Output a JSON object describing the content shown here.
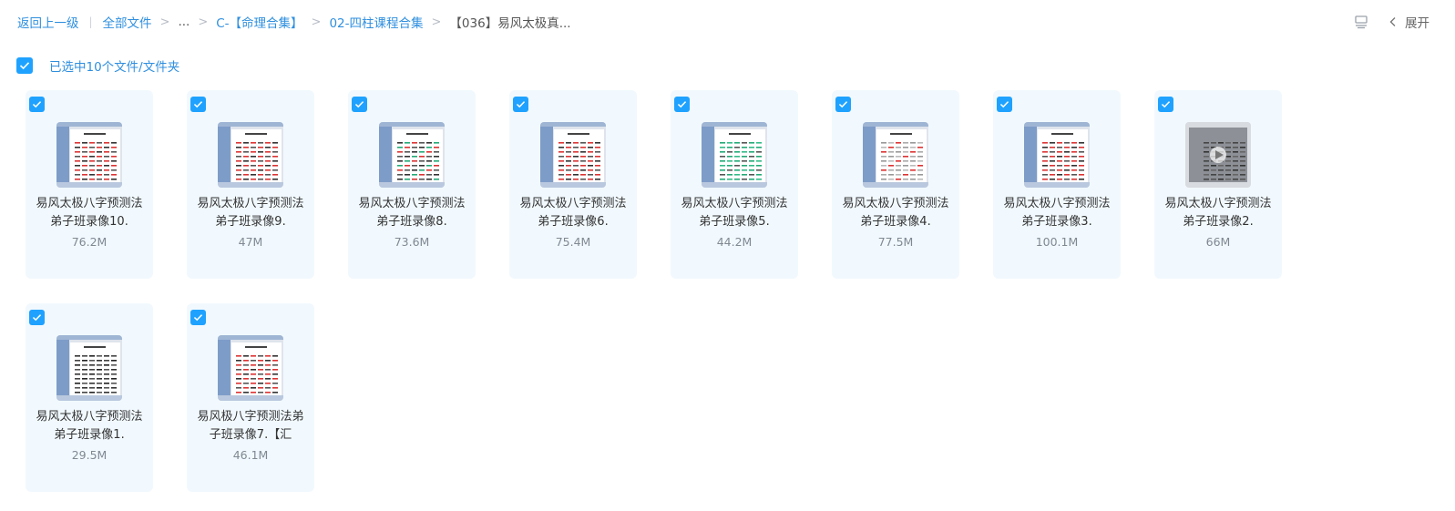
{
  "breadcrumb": {
    "back": "返回上一级",
    "all_files": "全部文件",
    "ellipsis": "...",
    "level1": "C-【命理合集】",
    "level2": "02-四柱课程合集",
    "current": "【036】易风太极真..."
  },
  "toolbar": {
    "expand": "展开",
    "view_icon": "list-view-icon"
  },
  "selection": {
    "text": "已选中10个文件/文件夹",
    "checked": true
  },
  "colors": {
    "accent": "#1fa2ff",
    "link": "#2f8fdf",
    "card_bg": "#f1f9fe"
  },
  "files": [
    {
      "name": "易风太极八字预测法弟子班录像10.",
      "size": "76.2M",
      "thumb": "ppt-red"
    },
    {
      "name": "易风太极八字预测法弟子班录像9.",
      "size": "47M",
      "thumb": "ppt-red"
    },
    {
      "name": "易风太极八字预测法弟子班录像8.",
      "size": "73.6M",
      "thumb": "ppt-mixed"
    },
    {
      "name": "易风太极八字预测法弟子班录像6.",
      "size": "75.4M",
      "thumb": "ppt-red"
    },
    {
      "name": "易风太极八字预测法弟子班录像5.",
      "size": "44.2M",
      "thumb": "ppt-green"
    },
    {
      "name": "易风太极八字预测法弟子班录像4.",
      "size": "77.5M",
      "thumb": "ppt-light"
    },
    {
      "name": "易风太极八字预测法弟子班录像3.",
      "size": "100.1M",
      "thumb": "ppt-red"
    },
    {
      "name": "易风太极八字预测法弟子班录像2.",
      "size": "66M",
      "thumb": "video-gray"
    },
    {
      "name": "易风太极八字预测法弟子班录像1.",
      "size": "29.5M",
      "thumb": "ppt-dark"
    },
    {
      "name": "易风极八字预测法弟子班录像7.【汇",
      "size": "46.1M",
      "thumb": "ppt-red"
    }
  ]
}
